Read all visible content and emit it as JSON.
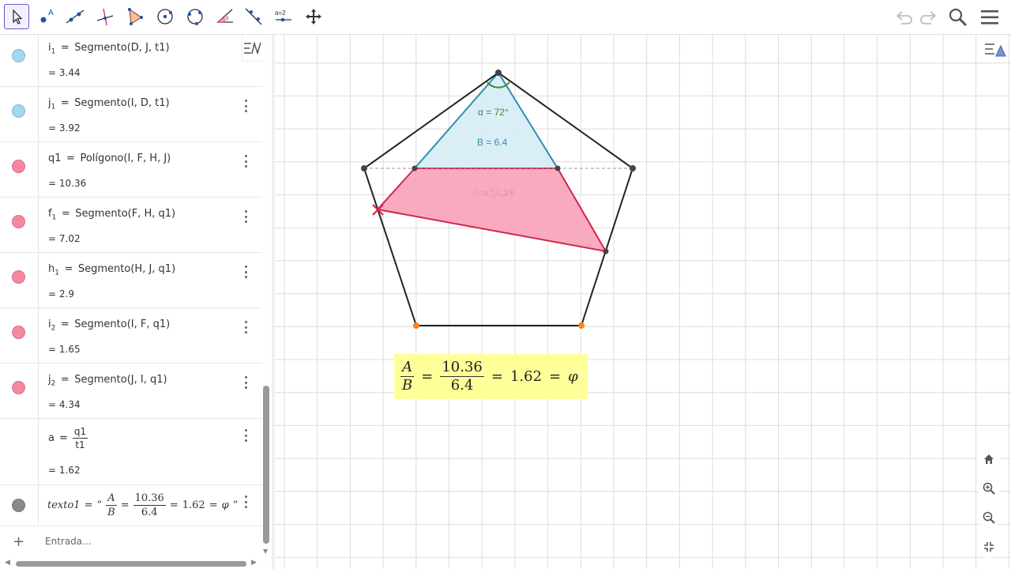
{
  "toolbar": {
    "tools": [
      {
        "name": "move-tool-icon",
        "active": true
      },
      {
        "name": "point-tool-icon",
        "active": false
      },
      {
        "name": "line-tool-icon",
        "active": false
      },
      {
        "name": "perpendicular-line-tool-icon",
        "active": false
      },
      {
        "name": "polygon-tool-icon",
        "active": false
      },
      {
        "name": "circle-center-point-tool-icon",
        "active": false
      },
      {
        "name": "circle-three-points-tool-icon",
        "active": false
      },
      {
        "name": "angle-tool-icon",
        "active": false
      },
      {
        "name": "reflect-tool-icon",
        "active": false
      },
      {
        "name": "slider-tool-icon",
        "label": "a=2",
        "active": false
      },
      {
        "name": "move-graphics-view-tool-icon",
        "active": false
      }
    ],
    "undo": "undo-icon",
    "redo": "redo-icon",
    "search": "search-icon",
    "menu": "menu-icon"
  },
  "algebra": {
    "rows": [
      {
        "id": "i1",
        "name": "i",
        "sub": "1",
        "definition": "Segmento(D, J, t1)",
        "value": "= 3.44",
        "color": "#a3d6ef"
      },
      {
        "id": "j1",
        "name": "j",
        "sub": "1",
        "definition": "Segmento(I, D, t1)",
        "value": "= 3.92",
        "color": "#a3d6ef"
      },
      {
        "id": "q1",
        "name": "q1",
        "sub": "",
        "definition": "Polígono(I, F, H, J)",
        "value": "= 10.36",
        "color": "#f5889f"
      },
      {
        "id": "f1",
        "name": "f",
        "sub": "1",
        "definition": "Segmento(F, H, q1)",
        "value": "= 7.02",
        "color": "#f5889f"
      },
      {
        "id": "h1",
        "name": "h",
        "sub": "1",
        "definition": "Segmento(H, J, q1)",
        "value": "= 2.9",
        "color": "#f5889f"
      },
      {
        "id": "i2",
        "name": "i",
        "sub": "2",
        "definition": "Segmento(I, F, q1)",
        "value": "= 1.65",
        "color": "#f5889f"
      },
      {
        "id": "j2",
        "name": "j",
        "sub": "2",
        "definition": "Segmento(J, I, q1)",
        "value": "= 4.34",
        "color": "#f5889f"
      }
    ],
    "ratio_row": {
      "name": "a",
      "num": "q1",
      "den": "t1",
      "value": "= 1.62"
    },
    "text_row": {
      "name": "texto1",
      "eq": "=",
      "open_quote": "“",
      "num1": "A",
      "den1": "B",
      "num2": "10.36",
      "den2": "6.4",
      "value": "1.62",
      "phi": "φ",
      "close_quote": "”",
      "color": "#8a8a8a"
    },
    "input_placeholder": "Entrada...",
    "add_symbol": "+"
  },
  "graphics": {
    "angle_label": "α = 72°",
    "triangle_label": "B = 6.4",
    "polygon_label": "A = 10.36",
    "formula": {
      "num1": "A",
      "den1": "B",
      "num2": "10.36",
      "den2": "6.4",
      "value": "1.62",
      "phi": "φ"
    },
    "colors": {
      "triangle_fill": "#d3ebf4",
      "triangle_stroke": "#2b8fb4",
      "quad_fill": "#f9a5ba",
      "quad_stroke": "#d1264d",
      "angle": "#3d8a3d",
      "pentagon": "#222222",
      "orange_point": "#f5831f",
      "formula_bg": "#ffff99"
    }
  }
}
